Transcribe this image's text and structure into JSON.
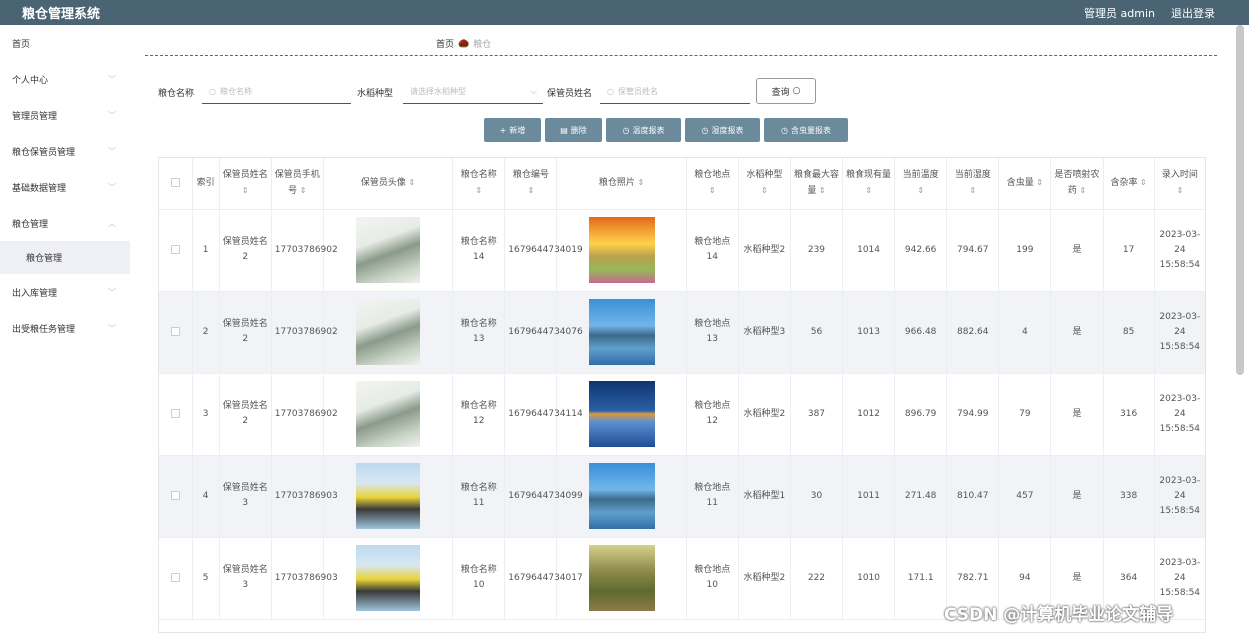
{
  "app": {
    "title": "粮仓管理系统"
  },
  "topbar": {
    "user_label": "管理员 admin",
    "logout_label": "退出登录"
  },
  "sidebar": {
    "items": [
      {
        "label": "首页",
        "chevron": false
      },
      {
        "label": "个人中心",
        "chevron": true
      },
      {
        "label": "管理员管理",
        "chevron": true
      },
      {
        "label": "粮仓保管员管理",
        "chevron": true
      },
      {
        "label": "基础数据管理",
        "chevron": true
      },
      {
        "label": "粮仓管理",
        "chevron": true,
        "expanded": true
      },
      {
        "label": "出入库管理",
        "chevron": true
      },
      {
        "label": "出受粮任务管理",
        "chevron": true
      }
    ],
    "sub_active": "粮仓管理"
  },
  "breadcrumb": {
    "home": "首页",
    "current": "粮仓"
  },
  "filters": {
    "name_label": "粮仓名称",
    "name_placeholder": "粮仓名称",
    "type_label": "水稻种型",
    "type_placeholder": "请选择水稻种型",
    "keeper_label": "保管员姓名",
    "keeper_placeholder": "保管员姓名",
    "search_label": "查询"
  },
  "actions": [
    {
      "label": "新增",
      "icon": "+"
    },
    {
      "label": "删除",
      "icon": "▤"
    },
    {
      "label": "温度报表",
      "icon": "◷"
    },
    {
      "label": "湿度报表",
      "icon": "◷"
    },
    {
      "label": "含虫量报表",
      "icon": "◷"
    }
  ],
  "table": {
    "columns": [
      "",
      "索引",
      "保管员姓名",
      "保管员手机号",
      "保管员头像",
      "粮仓名称",
      "粮仓编号",
      "粮仓照片",
      "粮仓地点",
      "水稻种型",
      "粮食最大容量",
      "粮食现有量",
      "当前温度",
      "当前湿度",
      "含虫量",
      "是否喷射农药",
      "含杂率",
      "录入时间"
    ],
    "rows": [
      {
        "index": "1",
        "keeper": "保管员姓名2",
        "phone": "17703786902",
        "avatar": "a",
        "name": "粮仓名称14",
        "code": "1679644734019",
        "photo": "sunset",
        "location": "粮仓地点14",
        "type": "水稻种型2",
        "max": "239",
        "current": "1014",
        "temp": "942.66",
        "humidity": "794.67",
        "insect": "199",
        "sprayed": "是",
        "impurity": "17",
        "time": "2023-03-24 15:58:54"
      },
      {
        "index": "2",
        "keeper": "保管员姓名2",
        "phone": "17703786902",
        "avatar": "a",
        "name": "粮仓名称13",
        "code": "1679644734076",
        "photo": "lake",
        "location": "粮仓地点13",
        "type": "水稻种型3",
        "max": "56",
        "current": "1013",
        "temp": "966.48",
        "humidity": "882.64",
        "insect": "4",
        "sprayed": "是",
        "impurity": "85",
        "time": "2023-03-24 15:58:54"
      },
      {
        "index": "3",
        "keeper": "保管员姓名2",
        "phone": "17703786902",
        "avatar": "a",
        "name": "粮仓名称12",
        "code": "1679644734114",
        "photo": "snow",
        "location": "粮仓地点12",
        "type": "水稻种型2",
        "max": "387",
        "current": "1012",
        "temp": "896.79",
        "humidity": "794.99",
        "insect": "79",
        "sprayed": "是",
        "impurity": "316",
        "time": "2023-03-24 15:58:54"
      },
      {
        "index": "4",
        "keeper": "保管员姓名3",
        "phone": "17703786903",
        "avatar": "b",
        "name": "粮仓名称11",
        "code": "1679644734099",
        "photo": "lake",
        "location": "粮仓地点11",
        "type": "水稻种型1",
        "max": "30",
        "current": "1011",
        "temp": "271.48",
        "humidity": "810.47",
        "insect": "457",
        "sprayed": "是",
        "impurity": "338",
        "time": "2023-03-24 15:58:54"
      },
      {
        "index": "5",
        "keeper": "保管员姓名3",
        "phone": "17703786903",
        "avatar": "b",
        "name": "粮仓名称10",
        "code": "1679644734017",
        "photo": "forest",
        "location": "粮仓地点10",
        "type": "水稻种型2",
        "max": "222",
        "current": "1010",
        "temp": "171.1",
        "humidity": "782.71",
        "insect": "94",
        "sprayed": "是",
        "impurity": "364",
        "time": "2023-03-24 15:58:54"
      }
    ]
  },
  "watermark": "CSDN @计算机毕业论文辅导"
}
